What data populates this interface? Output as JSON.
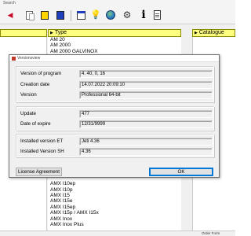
{
  "window": {
    "menu_label": "Search"
  },
  "toolbar": {
    "icons": [
      "back-arrow-icon",
      "copy-icon",
      "yellow-square-icon",
      "blue-square-icon",
      "window-icon",
      "lightbulb-icon",
      "globe-icon",
      "gear-icon",
      "info-icon",
      "document-icon"
    ]
  },
  "panels": {
    "type_header": "Type",
    "catalogue_header": "Catalogue"
  },
  "type_list": {
    "items_top": [
      "AM 20",
      "AM 2000",
      "AM 2000 GALVINOX"
    ],
    "items_bottom": [
      "AMX I10ep",
      "AMX I10p",
      "AMX I15",
      "AMX I15e",
      "AMX I15ep",
      "AMX I15p / AMX I15x",
      "AMX Inox",
      "AMX Inox Plus"
    ]
  },
  "dialog": {
    "title": "Versionsview",
    "version_of_program_label": "Version of program",
    "version_of_program": "4. 40, 0, 16",
    "creation_date_label": "Creation date",
    "creation_date": "14.07.2022 20:09:10",
    "version_label": "Version",
    "version": "Professional 64-bit",
    "update_label": "Update",
    "update": "477",
    "date_of_expire_label": "Date of expire",
    "date_of_expire": "12/31/9999",
    "installed_et_label": "Installed version ET",
    "installed_et": "Jeti 4.36",
    "installed_sh_label": "Installed Version SH",
    "installed_sh": "4.36",
    "license_button": "License Agreement",
    "ok_button": "OK"
  },
  "statusbar": {
    "text": "Order Form"
  },
  "colors": {
    "panel_header_bg": "#ffff80",
    "toolbar_accent_yellow": "#ffd400",
    "toolbar_accent_blue": "#1f3fbf",
    "ok_border": "#0078d7"
  }
}
